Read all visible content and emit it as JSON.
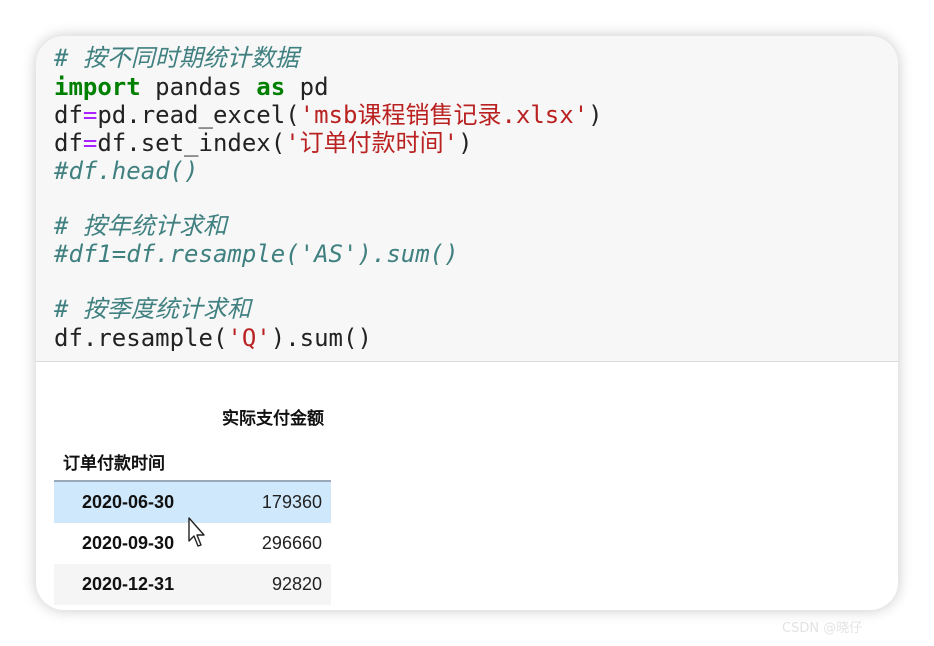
{
  "code": {
    "line1": "# 按不同时期统计数据",
    "line2_kw": "import",
    "line2_mid": " pandas ",
    "line2_as": "as",
    "line2_end": " pd",
    "line3_a": "df",
    "line3_op": "=",
    "line3_b": "pd.read_excel(",
    "line3_str": "'msb课程销售记录.xlsx'",
    "line3_c": ")",
    "line4_a": "df",
    "line4_op": "=",
    "line4_b": "df.set_index(",
    "line4_str": "'订单付款时间'",
    "line4_c": ")",
    "line5": "#df.head()",
    "line6": "# 按年统计求和",
    "line7": "#df1=df.resample('AS').sum()",
    "line8": "# 按季度统计求和",
    "line9_a": "df.resample(",
    "line9_str": "'Q'",
    "line9_b": ").sum()"
  },
  "table": {
    "column_header": "实际支付金额",
    "index_header": "订单付款时间",
    "rows": [
      {
        "index": "2020-06-30",
        "value": "179360",
        "bg": "#cfe8fc"
      },
      {
        "index": "2020-09-30",
        "value": "296660",
        "bg": "#ffffff"
      },
      {
        "index": "2020-12-31",
        "value": "92820",
        "bg": "#f5f5f5"
      }
    ]
  },
  "watermark": "CSDN @晓仔"
}
